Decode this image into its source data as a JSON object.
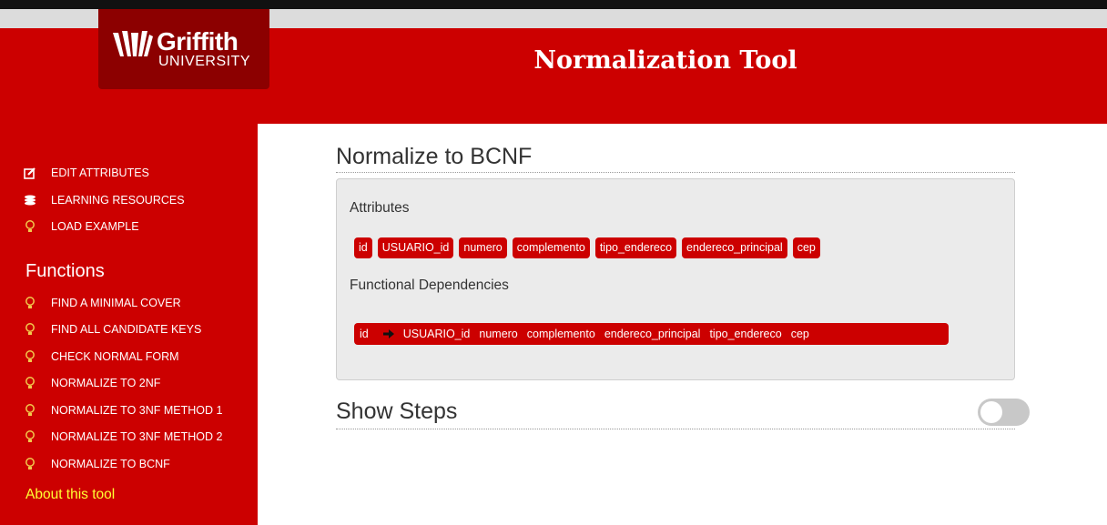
{
  "brand": {
    "name": "Griffith",
    "subname": "UNIVERSITY"
  },
  "header": {
    "title": "Normalization Tool"
  },
  "sidebar": {
    "top_items": [
      {
        "label": "EDIT ATTRIBUTES",
        "icon": "edit-icon"
      },
      {
        "label": "LEARNING RESOURCES",
        "icon": "database-icon"
      },
      {
        "label": "LOAD EXAMPLE",
        "icon": "lightbulb-icon"
      }
    ],
    "functions_heading": "Functions",
    "functions": [
      {
        "label": "FIND A MINIMAL COVER",
        "icon": "lightbulb-icon"
      },
      {
        "label": "FIND ALL CANDIDATE KEYS",
        "icon": "lightbulb-icon"
      },
      {
        "label": "CHECK NORMAL FORM",
        "icon": "lightbulb-icon"
      },
      {
        "label": "NORMALIZE TO 2NF",
        "icon": "lightbulb-icon"
      },
      {
        "label": "NORMALIZE TO 3NF METHOD 1",
        "icon": "lightbulb-icon"
      },
      {
        "label": "NORMALIZE TO 3NF METHOD 2",
        "icon": "lightbulb-icon"
      },
      {
        "label": "NORMALIZE TO BCNF",
        "icon": "lightbulb-icon"
      }
    ],
    "about": "About this tool"
  },
  "main": {
    "title": "Normalize to BCNF",
    "attributes_label": "Attributes",
    "attributes": [
      "id",
      "USUARIO_id",
      "numero",
      "complemento",
      "tipo_endereco",
      "endereco_principal",
      "cep"
    ],
    "fd_label": "Functional Dependencies",
    "fd": {
      "lhs": "id",
      "arrow_icon": "arrow-right-icon",
      "rhs": [
        "USUARIO_id",
        "numero",
        "complemento",
        "endereco_principal",
        "tipo_endereco",
        "cep"
      ]
    },
    "show_steps": {
      "label": "Show Steps",
      "enabled": false
    }
  },
  "colors": {
    "brand_red": "#cc0000",
    "dark_red": "#8c0000",
    "link_yellow": "#ffff33",
    "toggle_off": "#c8c8c8"
  }
}
